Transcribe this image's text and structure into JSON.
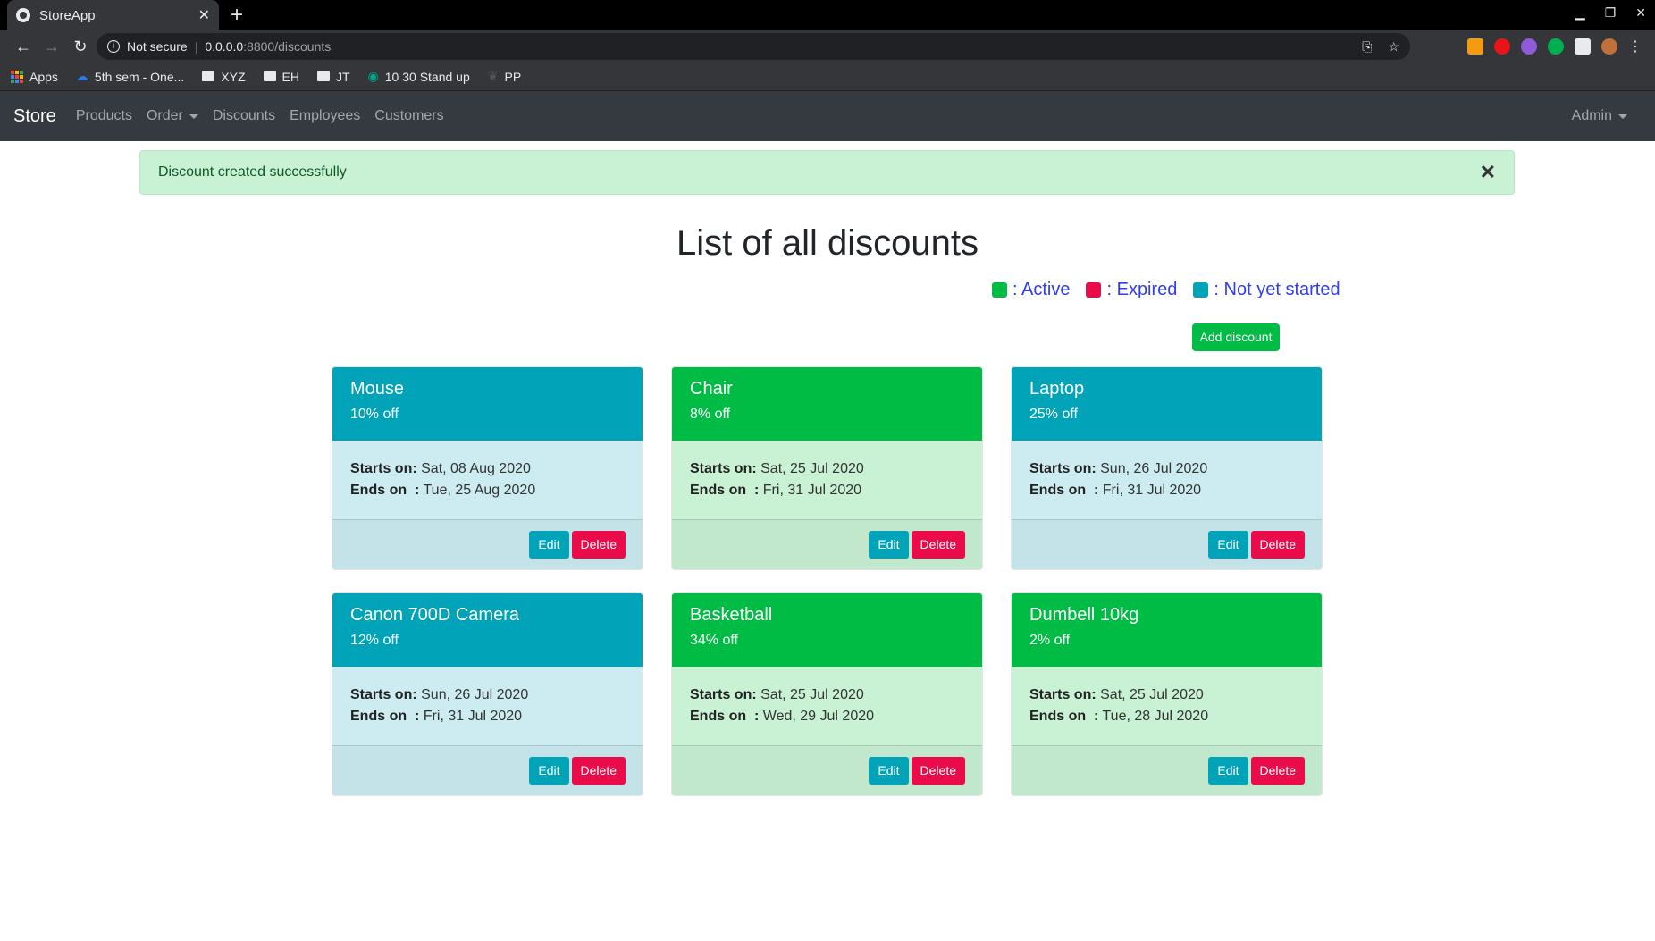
{
  "browser": {
    "tab_title": "StoreApp",
    "address": {
      "security": "Not secure",
      "host": "0.0.0.0",
      "path": ":8800/discounts"
    },
    "bookmarks": [
      "Apps",
      "5th sem - One...",
      "XYZ",
      "EH",
      "JT",
      "10 30 Stand up",
      "PP"
    ]
  },
  "navbar": {
    "brand": "Store",
    "links": [
      "Products",
      "Order",
      "Discounts",
      "Employees",
      "Customers"
    ],
    "user": "Admin"
  },
  "alert": {
    "message": "Discount created successfully"
  },
  "page": {
    "title": "List of all discounts",
    "add_button": "Add discount"
  },
  "legend": [
    {
      "label": ": Active",
      "color": "#00bb44"
    },
    {
      "label": ": Expired",
      "color": "#ea0b4a"
    },
    {
      "label": ": Not yet started",
      "color": "#00a3b7"
    }
  ],
  "labels": {
    "starts": "Starts on:",
    "ends": "Ends on  :",
    "edit": "Edit",
    "delete": "Delete"
  },
  "discounts": [
    {
      "name": "Mouse",
      "off": "10% off",
      "starts": "Sat, 08 Aug 2020",
      "ends": "Tue, 25 Aug 2020",
      "status": "teal"
    },
    {
      "name": "Chair",
      "off": "8% off",
      "starts": "Sat, 25 Jul 2020",
      "ends": "Fri, 31 Jul 2020",
      "status": "green"
    },
    {
      "name": "Laptop",
      "off": "25% off",
      "starts": "Sun, 26 Jul 2020",
      "ends": "Fri, 31 Jul 2020",
      "status": "teal"
    },
    {
      "name": "Canon 700D Camera",
      "off": "12% off",
      "starts": "Sun, 26 Jul 2020",
      "ends": "Fri, 31 Jul 2020",
      "status": "teal"
    },
    {
      "name": "Basketball",
      "off": "34% off",
      "starts": "Sat, 25 Jul 2020",
      "ends": "Wed, 29 Jul 2020",
      "status": "green"
    },
    {
      "name": "Dumbell 10kg",
      "off": "2% off",
      "starts": "Sat, 25 Jul 2020",
      "ends": "Tue, 28 Jul 2020",
      "status": "green"
    }
  ]
}
